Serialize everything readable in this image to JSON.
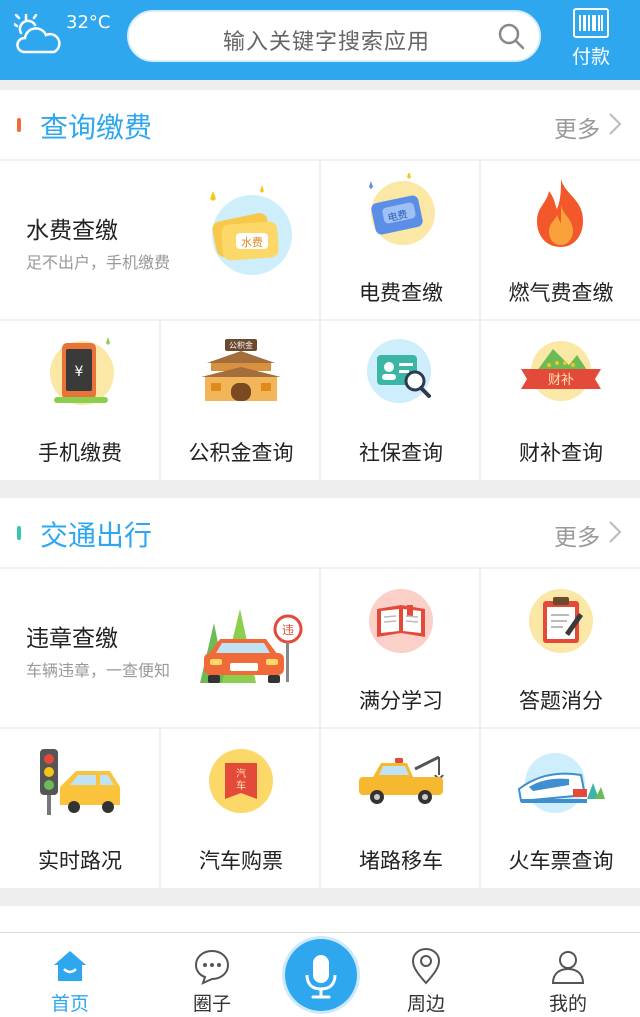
{
  "header": {
    "temperature": "32°C",
    "weather_icon": "cloudy-sun-icon",
    "search_placeholder": "输入关键字搜索应用",
    "pay_label": "付款"
  },
  "sections": [
    {
      "title": "查询缴费",
      "more": "更多",
      "accent": "#f26b3a",
      "feature": {
        "title": "水费查缴",
        "subtitle": "足不出户，手机缴费"
      },
      "items": [
        "电费查缴",
        "燃气费查缴",
        "手机缴费",
        "公积金查询",
        "社保查询",
        "财补查询"
      ]
    },
    {
      "title": "交通出行",
      "more": "更多",
      "accent": "#36c7b0",
      "feature": {
        "title": "违章查缴",
        "subtitle": "车辆违章，一查便知"
      },
      "items": [
        "满分学习",
        "答题消分",
        "实时路况",
        "汽车购票",
        "堵路移车",
        "火车票查询"
      ]
    }
  ],
  "tabbar": {
    "tabs": [
      "首页",
      "圈子",
      "周边",
      "我的"
    ],
    "active": "首页"
  },
  "colors": {
    "primary": "#2ea7ef"
  }
}
